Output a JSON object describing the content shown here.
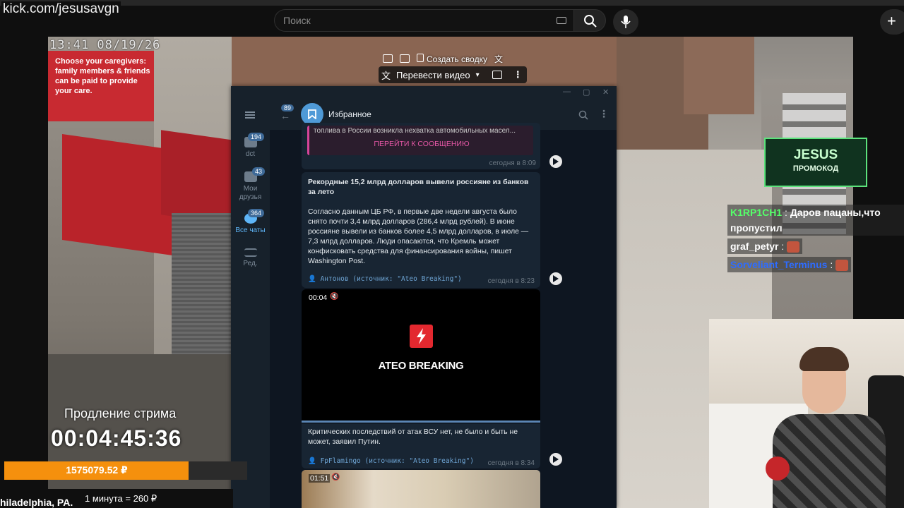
{
  "browser": {
    "url": "kick.com/jesusavgn",
    "search_placeholder": "Поиск",
    "plus_label": "+"
  },
  "stream": {
    "camera_timestamp": "13:41 08/19/26",
    "sign_text": "Choose your caregivers: family members & friends can be paid to provide your care.",
    "extend_label": "Продление стрима",
    "timer": "00:04:45:36",
    "donation_amount": "1575079.52 ₽",
    "donation_progress": 0.76,
    "location": "hiladelphia, PA.",
    "rate": "1 минута = 260 ₽"
  },
  "translate_bar": {
    "summary_label": "Создать сводку",
    "translate_label": "Перевести видео"
  },
  "telegram": {
    "chat_title": "Избранное",
    "back_badge": "89",
    "sidebar": [
      {
        "label": "dct",
        "badge": "194",
        "icon": "folder-icon"
      },
      {
        "label": "Мои друзья",
        "badge": "43",
        "icon": "folder-icon"
      },
      {
        "label": "Все чаты",
        "badge": "364",
        "icon": "chats-icon"
      },
      {
        "label": "Ред.",
        "badge": "",
        "icon": "sliders-icon"
      }
    ],
    "messages": [
      {
        "quote": "топлива в России возникла нехватка автомобильных масел...",
        "button": "ПЕРЕЙТИ К СООБЩЕНИЮ",
        "time": "сегодня в 8:09"
      },
      {
        "title": "Рекордные 15,2 млрд долларов вывели россияне из банков за лето",
        "body": "Согласно данным ЦБ РФ, в первые две недели августа было снято почти 3,4 млрд долларов (286,4 млрд рублей). В июне россияне вывели из банков более 4,5 млрд долларов, в июле — 7,3 млрд долларов. Люди опасаются, что Кремль может конфисковать средства для финансирования войны, пишет Washington Post.",
        "author": "Антонов (источник: \"Ateo Breaking\")",
        "time": "сегодня в 8:23"
      },
      {
        "video_time": "00:04",
        "video_brand": "ATEO BREAKING",
        "body": "Критических последствий от атак ВСУ нет, не было и быть не может, заявил Путин.",
        "author": "FpFlamingo (источник: \"Ateo Breaking\")",
        "time": "сегодня в 8:34"
      },
      {
        "video_time": "01:51"
      }
    ]
  },
  "promo": {
    "title": "JESUS",
    "subtitle": "ПРОМОКОД"
  },
  "stream_chat": [
    {
      "user": "K1RP1CH1",
      "text": "Даров пацаны,что пропустил"
    },
    {
      "user": "graf_petyr",
      "text": ""
    },
    {
      "user": "Sorveliant_Terminus",
      "text": ""
    }
  ],
  "colors": {
    "accent_orange": "#f5900d",
    "telegram_bg": "#0e1621",
    "promo_green": "#5ce37c"
  }
}
